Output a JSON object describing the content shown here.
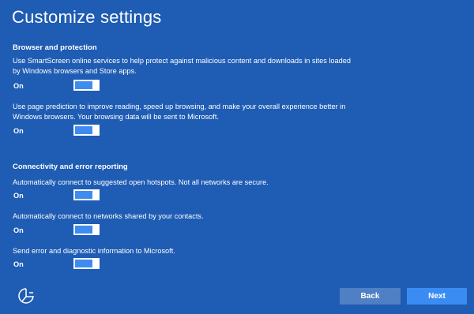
{
  "page": {
    "title": "Customize settings"
  },
  "sections": [
    {
      "header": "Browser and protection",
      "settings": [
        {
          "description": "Use SmartScreen online services to help protect against malicious content and downloads in sites loaded by Windows browsers and Store apps.",
          "state": "On"
        },
        {
          "description": "Use page prediction to improve reading, speed up browsing, and make your overall experience better in Windows browsers. Your browsing data will be sent to Microsoft.",
          "state": "On"
        }
      ]
    },
    {
      "header": "Connectivity and error reporting",
      "settings": [
        {
          "description": "Automatically connect to suggested open hotspots. Not all networks are secure.",
          "state": "On"
        },
        {
          "description": "Automatically connect to networks shared by your contacts.",
          "state": "On"
        },
        {
          "description": "Send error and diagnostic information to Microsoft.",
          "state": "On"
        }
      ]
    }
  ],
  "footer": {
    "accessibility_icon": "ease-of-access-icon",
    "back_label": "Back",
    "next_label": "Next"
  },
  "colors": {
    "background": "#1f5cb3",
    "toggle_on": "#3f8cf0",
    "next_button": "#3a8cf2",
    "back_button": "#4f7fc4",
    "text": "#ffffff"
  }
}
